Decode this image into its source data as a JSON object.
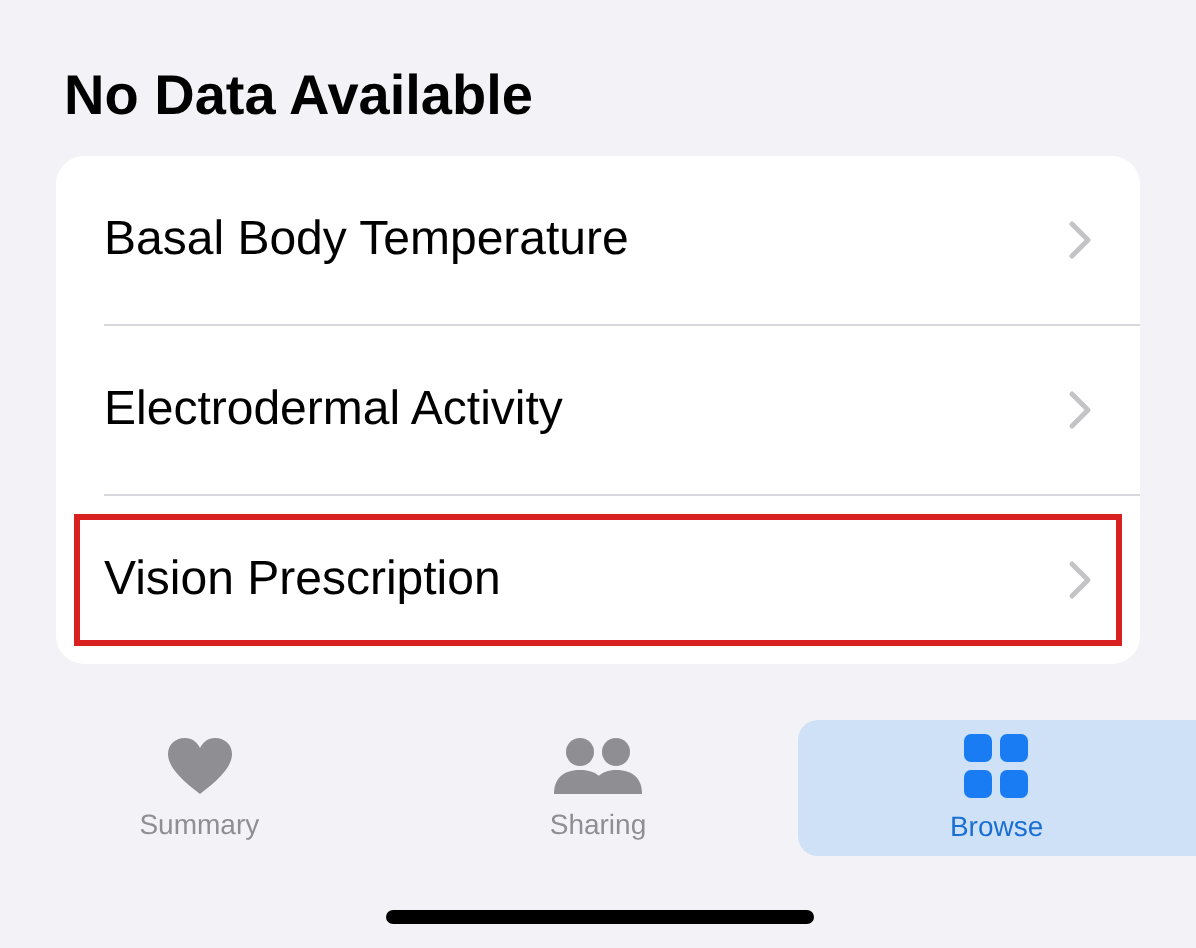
{
  "section": {
    "title": "No Data Available"
  },
  "rows": [
    {
      "label": "Basal Body Temperature",
      "highlighted": false
    },
    {
      "label": "Electrodermal Activity",
      "highlighted": false
    },
    {
      "label": "Vision Prescription",
      "highlighted": true
    }
  ],
  "tab_bar": [
    {
      "label": "Summary",
      "kind": "heart",
      "selected": false
    },
    {
      "label": "Sharing",
      "kind": "people",
      "selected": false
    },
    {
      "label": "Browse",
      "kind": "grid",
      "selected": true
    }
  ]
}
